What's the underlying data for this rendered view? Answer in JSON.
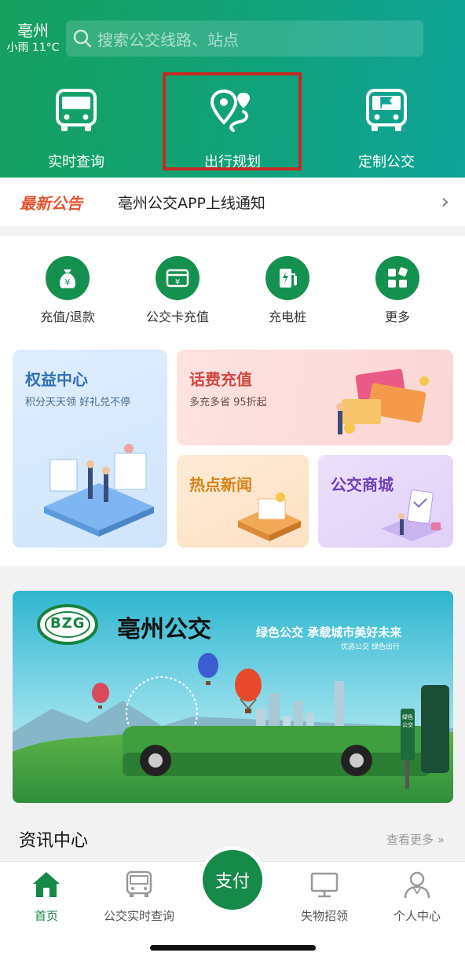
{
  "header": {
    "city": "亳州",
    "weather": "小雨 11°C",
    "search_placeholder": "搜索公交线路、站点",
    "features": [
      {
        "label": "实时查询",
        "icon": "bus-icon"
      },
      {
        "label": "出行规划",
        "icon": "route-pin-icon"
      },
      {
        "label": "定制公交",
        "icon": "bus-flag-icon"
      }
    ]
  },
  "notice": {
    "tag": "最新公告",
    "text": "亳州公交APP上线通知"
  },
  "quick_actions": [
    {
      "label": "充值/退款",
      "icon": "money-bag-icon"
    },
    {
      "label": "公交卡充值",
      "icon": "card-recharge-icon"
    },
    {
      "label": "充电桩",
      "icon": "charging-pile-icon"
    },
    {
      "label": "更多",
      "icon": "grid-more-icon"
    }
  ],
  "promo_cards": {
    "rights": {
      "title": "权益中心",
      "subtitle": "积分天天领 好礼兑不停"
    },
    "phone": {
      "title": "话费充值",
      "subtitle": "多充多省 95折起"
    },
    "news": {
      "title": "热点新闻"
    },
    "mall": {
      "title": "公交商城"
    }
  },
  "banner": {
    "logo_text": "BZG",
    "brand": "亳州公交",
    "slogan": "绿色公交 承载城市美好未来",
    "sub_slogan": "优选公交 绿色出行",
    "sign_text": "绿色公交"
  },
  "news_section": {
    "title": "资讯中心",
    "more": "查看更多 »"
  },
  "tabbar": {
    "items": [
      {
        "label": "首页",
        "icon": "home-icon"
      },
      {
        "label": "公交实时查询",
        "icon": "bus-icon"
      },
      {
        "label": "失物招领",
        "icon": "monitor-icon"
      },
      {
        "label": "个人中心",
        "icon": "person-icon"
      }
    ],
    "pay_label": "支付"
  },
  "colors": {
    "brand_green": "#158a49",
    "header_start": "#16a05e",
    "header_end": "#0fa39a",
    "notice_tag": "#e8542f",
    "highlight_box": "#c62a24"
  }
}
